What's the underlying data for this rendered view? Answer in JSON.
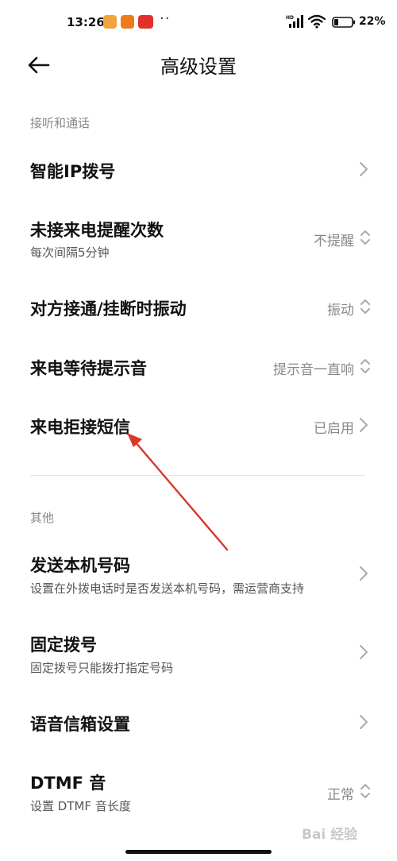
{
  "status_bar": {
    "time": "13:26",
    "notifications": [
      "mi-app-icon",
      "xiaomi-icon",
      "news-app-icon"
    ],
    "more": "··",
    "signal_label": "HD",
    "battery": "22%"
  },
  "header": {
    "title": "高级设置"
  },
  "sections": {
    "calls": {
      "title": "接听和通话",
      "items": [
        {
          "title": "智能IP拨号"
        },
        {
          "title": "未接来电提醒次数",
          "subtitle": "每次间隔5分钟",
          "value": "不提醒"
        },
        {
          "title": "对方接通/挂断时振动",
          "value": "振动"
        },
        {
          "title": "来电等待提示音",
          "value": "提示音一直响"
        },
        {
          "title": "来电拒接短信",
          "value": "已启用"
        }
      ]
    },
    "other": {
      "title": "其他",
      "items": [
        {
          "title": "发送本机号码",
          "subtitle": "设置在外拨电话时是否发送本机号码，需运营商支持"
        },
        {
          "title": "固定拨号",
          "subtitle": "固定拨号只能拨打指定号码"
        },
        {
          "title": "语音信箱设置"
        },
        {
          "title": "DTMF 音",
          "subtitle": "设置 DTMF 音长度",
          "value": "正常"
        }
      ]
    }
  },
  "watermark": "Bai 经验",
  "colors": {
    "annotation_arrow": "#d8372a",
    "secondary_text": "#888888"
  }
}
